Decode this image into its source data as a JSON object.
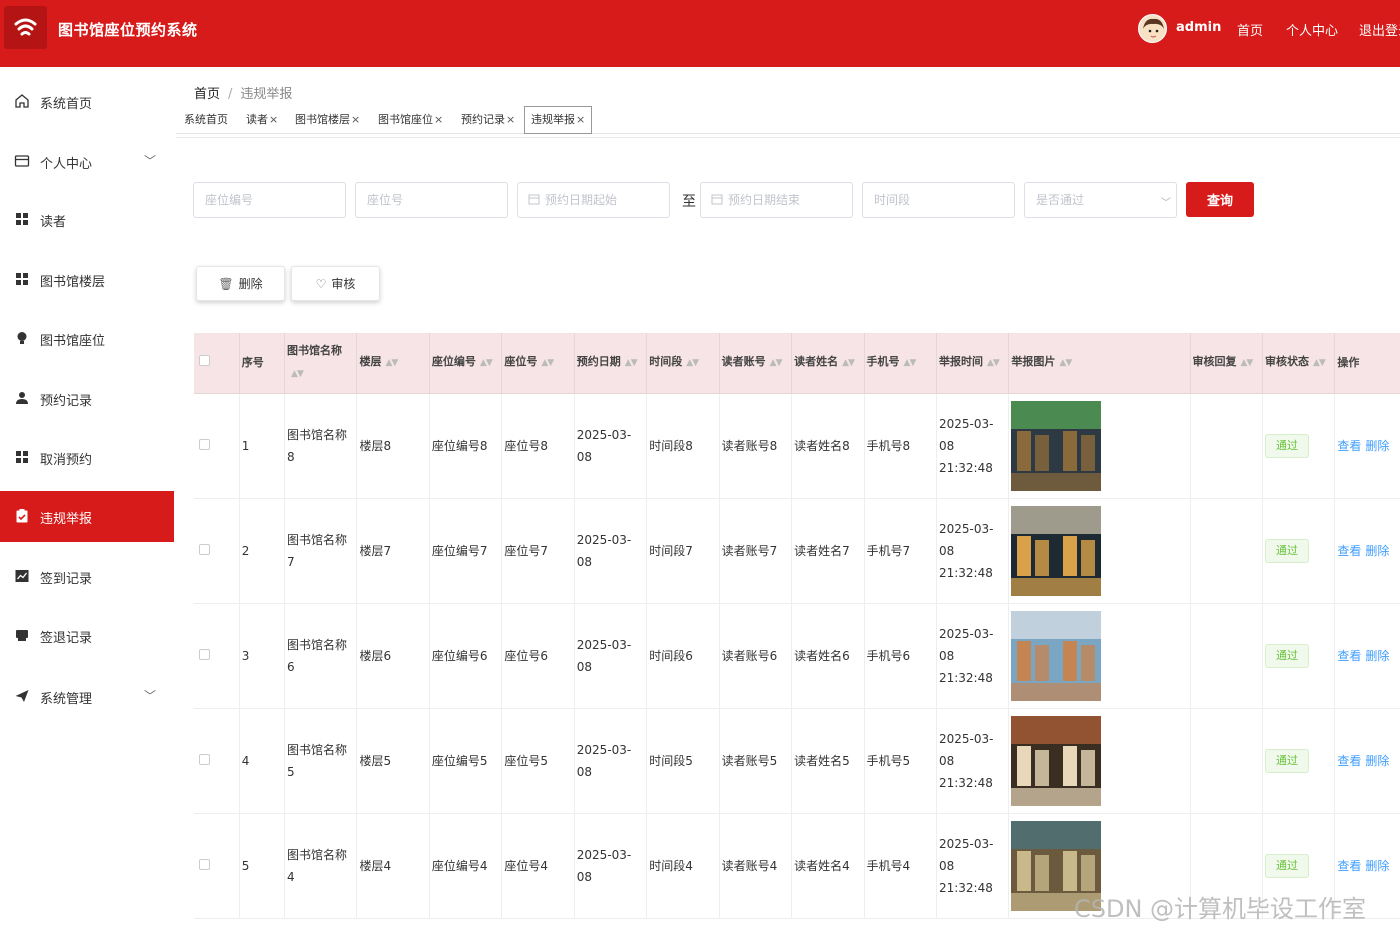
{
  "header": {
    "app_title": "图书馆座位预约系统",
    "user_name": "admin",
    "links": {
      "home": "首页",
      "profile": "个人中心",
      "logout": "退出登录"
    },
    "brand_color": "#d71a1a"
  },
  "sidebar": {
    "items": [
      {
        "label": "系统首页",
        "icon": "home-icon"
      },
      {
        "label": "个人中心",
        "icon": "card-icon",
        "expandable": true
      },
      {
        "label": "读者",
        "icon": "grid-icon"
      },
      {
        "label": "图书馆楼层",
        "icon": "grid-icon"
      },
      {
        "label": "图书馆座位",
        "icon": "bulb-icon"
      },
      {
        "label": "预约记录",
        "icon": "user-icon"
      },
      {
        "label": "取消预约",
        "icon": "grid-icon"
      },
      {
        "label": "违规举报",
        "icon": "clipboard-icon",
        "active": true
      },
      {
        "label": "签到记录",
        "icon": "chart-icon"
      },
      {
        "label": "签退记录",
        "icon": "printer-icon"
      },
      {
        "label": "系统管理",
        "icon": "send-icon",
        "expandable": true
      }
    ]
  },
  "breadcrumb": {
    "home": "首页",
    "separator": "/",
    "current": "违规举报"
  },
  "tabs": [
    {
      "label": "系统首页",
      "closable": false
    },
    {
      "label": "读者",
      "closable": true
    },
    {
      "label": "图书馆楼层",
      "closable": true
    },
    {
      "label": "图书馆座位",
      "closable": true
    },
    {
      "label": "预约记录",
      "closable": true
    },
    {
      "label": "违规举报",
      "closable": true,
      "active": true
    }
  ],
  "tab_close_glyph": "×",
  "filters": {
    "seat_code": {
      "placeholder": "座位编号",
      "value": ""
    },
    "seat_no": {
      "placeholder": "座位号",
      "value": ""
    },
    "date_start": {
      "placeholder": "预约日期起始",
      "value": ""
    },
    "to_label": "至",
    "date_end": {
      "placeholder": "预约日期结束",
      "value": ""
    },
    "time_slot": {
      "placeholder": "时间段",
      "value": ""
    },
    "approved": {
      "placeholder": "是否通过",
      "value": ""
    },
    "search_label": "查询"
  },
  "actions": {
    "delete_label": "删除",
    "review_label": "审核"
  },
  "table": {
    "columns": [
      "序号",
      "图书馆名称",
      "楼层",
      "座位编号",
      "座位号",
      "预约日期",
      "时间段",
      "读者账号",
      "读者姓名",
      "手机号",
      "举报时间",
      "举报图片",
      "审核回复",
      "审核状态",
      "操作"
    ],
    "rows": [
      {
        "index": "1",
        "library": "图书馆名称8",
        "floor": "楼层8",
        "seat_code": "座位编号8",
        "seat_no": "座位号8",
        "date": "2025-03-08",
        "slot": "时间段8",
        "account": "读者账号8",
        "name": "读者姓名8",
        "phone": "手机号8",
        "report_time": "2025-03-08 21:32:48",
        "reply": "",
        "status": "通过",
        "view": "查看",
        "delete": "删除"
      },
      {
        "index": "2",
        "library": "图书馆名称7",
        "floor": "楼层7",
        "seat_code": "座位编号7",
        "seat_no": "座位号7",
        "date": "2025-03-08",
        "slot": "时间段7",
        "account": "读者账号7",
        "name": "读者姓名7",
        "phone": "手机号7",
        "report_time": "2025-03-08 21:32:48",
        "reply": "",
        "status": "通过",
        "view": "查看",
        "delete": "删除"
      },
      {
        "index": "3",
        "library": "图书馆名称6",
        "floor": "楼层6",
        "seat_code": "座位编号6",
        "seat_no": "座位号6",
        "date": "2025-03-08",
        "slot": "时间段6",
        "account": "读者账号6",
        "name": "读者姓名6",
        "phone": "手机号6",
        "report_time": "2025-03-08 21:32:48",
        "reply": "",
        "status": "通过",
        "view": "查看",
        "delete": "删除"
      },
      {
        "index": "4",
        "library": "图书馆名称5",
        "floor": "楼层5",
        "seat_code": "座位编号5",
        "seat_no": "座位号5",
        "date": "2025-03-08",
        "slot": "时间段5",
        "account": "读者账号5",
        "name": "读者姓名5",
        "phone": "手机号5",
        "report_time": "2025-03-08 21:32:48",
        "reply": "",
        "status": "通过",
        "view": "查看",
        "delete": "删除"
      },
      {
        "index": "5",
        "library": "图书馆名称4",
        "floor": "楼层4",
        "seat_code": "座位编号4",
        "seat_no": "座位号4",
        "date": "2025-03-08",
        "slot": "时间段4",
        "account": "读者账号4",
        "name": "读者姓名4",
        "phone": "手机号4",
        "report_time": "2025-03-08 21:32:48",
        "reply": "",
        "status": "通过",
        "view": "查看",
        "delete": "删除"
      }
    ]
  },
  "watermark": "CSDN @计算机毕设工作室"
}
